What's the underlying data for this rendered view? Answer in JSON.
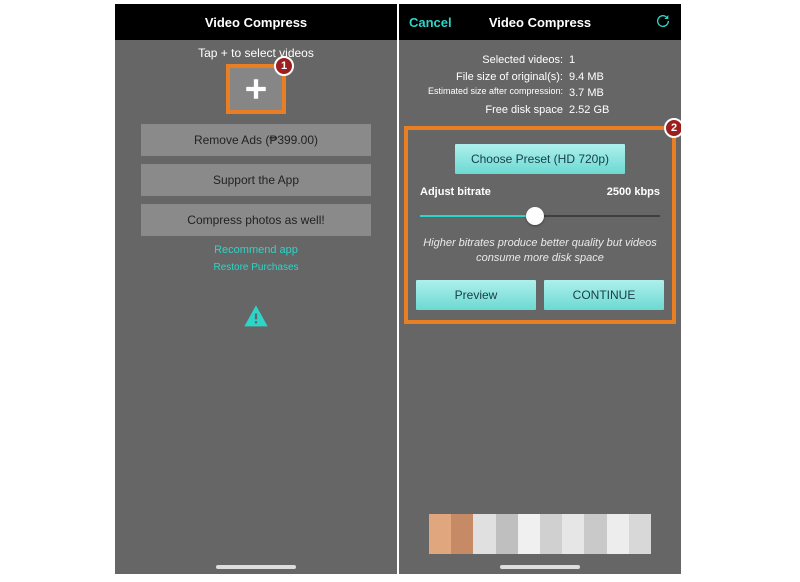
{
  "left": {
    "title": "Video Compress",
    "tap_hint": "Tap + to select videos",
    "remove_ads": "Remove Ads (₱399.00)",
    "support": "Support the App",
    "compress_photos": "Compress photos as well!",
    "recommend": "Recommend app",
    "restore": "Restore Purchases",
    "badge": "1"
  },
  "right": {
    "cancel": "Cancel",
    "title": "Video Compress",
    "info": {
      "selected_label": "Selected videos:",
      "selected_val": "1",
      "original_label": "File size of original(s):",
      "original_val": "9.4 MB",
      "compressed_label": "Estimated size after compression:",
      "compressed_val": "3.7 MB",
      "free_label": "Free disk space",
      "free_val": "2.52 GB"
    },
    "preset": "Choose Preset (HD 720p)",
    "adjust_label": "Adjust bitrate",
    "bitrate_val": "2500 kbps",
    "hint": "Higher bitrates produce better quality but videos consume more disk space",
    "preview": "Preview",
    "continue": "CONTINUE",
    "badge": "2"
  }
}
